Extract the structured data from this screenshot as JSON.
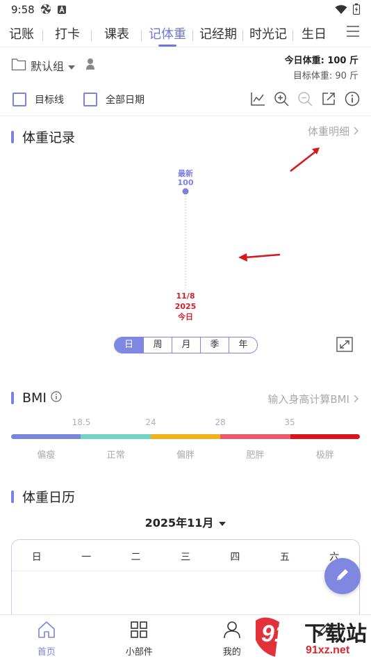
{
  "status": {
    "time": "9:58"
  },
  "tabs": [
    {
      "label": "记账"
    },
    {
      "label": "打卡"
    },
    {
      "label": "课表"
    },
    {
      "label": "记体重"
    },
    {
      "label": "记经期"
    },
    {
      "label": "时光记"
    },
    {
      "label": "生日"
    }
  ],
  "header": {
    "group_label": "默认组",
    "today_weight": "今日体重: 100 斤",
    "target_weight": "目标体重: 90 斤"
  },
  "options": {
    "target_line_label": "目标线",
    "all_dates_label": "全部日期"
  },
  "weight_record": {
    "title": "体重记录",
    "detail_link": "体重明细"
  },
  "chart_data": {
    "type": "line",
    "x": [
      "11/8 2025"
    ],
    "series": [
      {
        "values": [
          100
        ]
      }
    ],
    "point_label_top": "最新",
    "point_value": "100",
    "date_day": "11/8",
    "date_year": "2025",
    "date_today": "今日"
  },
  "period": {
    "items": [
      "日",
      "周",
      "月",
      "季",
      "年"
    ],
    "selected": "日"
  },
  "bmi": {
    "title": "BMI",
    "link": "输入身高计算BMI",
    "ticks": [
      "18.5",
      "24",
      "28",
      "35"
    ],
    "categories": [
      "偏瘦",
      "正常",
      "偏胖",
      "肥胖",
      "极胖"
    ],
    "colors": [
      "#7a86d8",
      "#72d4c6",
      "#f2b21b",
      "#ea5a6a",
      "#d9141b"
    ]
  },
  "calendar": {
    "title": "体重日历",
    "month": "2025年11月",
    "weekdays": [
      "日",
      "一",
      "二",
      "三",
      "四",
      "五",
      "六"
    ]
  },
  "bottom_nav": [
    {
      "label": "首页"
    },
    {
      "label": "小部件"
    },
    {
      "label": "我的"
    }
  ],
  "colors": {
    "accent": "#7b82e0",
    "today_red": "#d0202a"
  },
  "watermark": {
    "brand": "下载站",
    "domain": "91xz.net",
    "number": "91"
  }
}
